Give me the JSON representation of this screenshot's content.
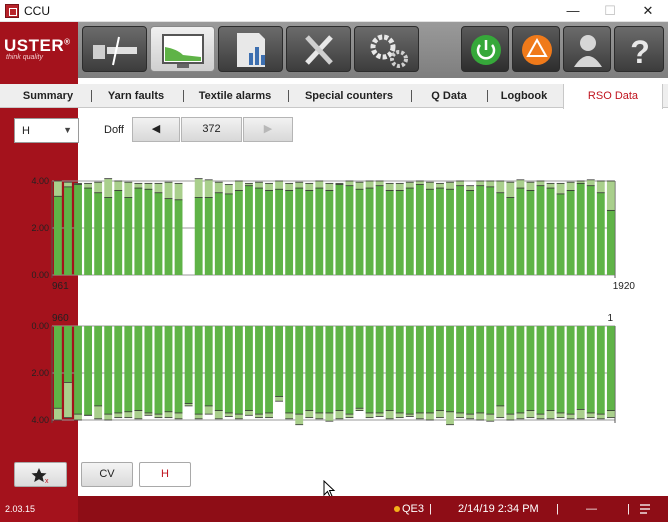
{
  "window": {
    "title": "CCU",
    "minimize": "—",
    "maximize": "☐",
    "close": "✕"
  },
  "brand": {
    "logo": "USTER",
    "reg": "®",
    "tagline": "think quality",
    "version": "2.03.15"
  },
  "toolbar": {
    "buttons": [
      {
        "name": "yarn-path-button",
        "icon": "yarn-path-icon"
      },
      {
        "name": "monitor-button",
        "icon": "monitor-chart-icon",
        "active": true
      },
      {
        "name": "report-button",
        "icon": "report-icon"
      },
      {
        "name": "tools-button",
        "icon": "tools-icon"
      },
      {
        "name": "settings-button",
        "icon": "gears-icon"
      },
      {
        "name": "power-button",
        "icon": "power-icon"
      },
      {
        "name": "alarm-button",
        "icon": "alarm-triangle-icon"
      },
      {
        "name": "user-button",
        "icon": "user-icon"
      },
      {
        "name": "help-button",
        "icon": "help-icon"
      }
    ]
  },
  "tabs": [
    {
      "label": "Summary"
    },
    {
      "label": "Yarn faults"
    },
    {
      "label": "Textile alarms"
    },
    {
      "label": "Special counters"
    },
    {
      "label": "Q Data"
    },
    {
      "label": "Logbook"
    },
    {
      "label": "RSO Data",
      "active": true
    }
  ],
  "controls": {
    "select_value": "H",
    "doff_label": "Doff",
    "prev_label": "◀",
    "doff_value": "372",
    "next_label": "▶"
  },
  "chart_data": [
    {
      "type": "bar",
      "orientation": "upward",
      "yticks": [
        "4.00",
        "2.00",
        "0.00"
      ],
      "ylim": [
        0,
        4
      ],
      "x_start_label": "961",
      "x_end_label": "1920",
      "series": [
        {
          "values": [
            3.35,
            3.75,
            3.85,
            3.7,
            3.5,
            3.3,
            3.6,
            3.3,
            3.7,
            3.65,
            3.5,
            3.25,
            3.2,
            0,
            3.3,
            3.3,
            3.5,
            3.45,
            3.6,
            3.8,
            3.7,
            3.6,
            3.65,
            3.6,
            3.7,
            3.6,
            3.7,
            3.6,
            3.85,
            3.8,
            3.65,
            3.7,
            3.8,
            3.6,
            3.6,
            3.7,
            3.85,
            3.65,
            3.7,
            3.65,
            3.8,
            3.6,
            3.8,
            3.75,
            3.5,
            3.3,
            3.7,
            3.6,
            3.8,
            3.7,
            3.45,
            3.6,
            3.9,
            3.8,
            3.5,
            2.75
          ]
        },
        {
          "values": [
            4.0,
            3.95,
            3.9,
            3.9,
            3.95,
            4.1,
            4.0,
            3.95,
            3.9,
            3.9,
            3.9,
            3.95,
            3.9,
            0,
            4.1,
            4.05,
            3.95,
            3.85,
            4.0,
            3.9,
            3.95,
            3.9,
            4.0,
            3.9,
            3.95,
            3.9,
            4.0,
            3.9,
            3.9,
            4.0,
            3.95,
            4.0,
            4.0,
            3.9,
            3.9,
            3.95,
            4.0,
            3.95,
            3.9,
            3.95,
            4.0,
            3.8,
            4.0,
            4.0,
            4.0,
            3.95,
            4.05,
            3.95,
            4.0,
            3.9,
            3.9,
            3.95,
            4.0,
            4.05,
            4.0,
            4.0
          ]
        }
      ]
    },
    {
      "type": "bar",
      "orientation": "downward",
      "yticks": [
        "0.00",
        "2.00",
        "4.00"
      ],
      "ylim": [
        0,
        4
      ],
      "x_start_label": "960",
      "x_end_label": "1",
      "series": [
        {
          "values": [
            3.5,
            2.4,
            3.75,
            3.8,
            3.4,
            3.75,
            3.7,
            3.65,
            3.6,
            3.7,
            3.75,
            3.65,
            3.7,
            3.3,
            3.75,
            3.4,
            3.6,
            3.7,
            3.75,
            3.6,
            3.75,
            3.7,
            3.0,
            3.7,
            3.75,
            3.6,
            3.7,
            3.7,
            3.6,
            3.75,
            3.5,
            3.7,
            3.7,
            3.6,
            3.7,
            3.75,
            3.7,
            3.7,
            3.6,
            3.65,
            3.7,
            3.75,
            3.7,
            3.75,
            3.4,
            3.75,
            3.7,
            3.6,
            3.75,
            3.6,
            3.7,
            3.75,
            3.55,
            3.7,
            3.75,
            3.6
          ]
        },
        {
          "values": [
            4.0,
            3.9,
            4.0,
            3.8,
            3.95,
            4.0,
            3.9,
            3.9,
            3.95,
            3.8,
            3.9,
            3.9,
            3.95,
            3.4,
            3.95,
            3.75,
            3.95,
            3.85,
            3.95,
            3.8,
            3.9,
            3.9,
            3.2,
            3.95,
            4.2,
            3.9,
            3.95,
            4.05,
            3.95,
            3.9,
            3.6,
            3.9,
            3.85,
            3.95,
            3.9,
            3.85,
            3.95,
            4.0,
            3.9,
            4.2,
            3.9,
            3.95,
            4.0,
            4.05,
            3.9,
            4.0,
            3.95,
            3.9,
            3.95,
            3.95,
            3.9,
            3.95,
            3.95,
            3.9,
            3.95,
            3.9
          ]
        }
      ]
    }
  ],
  "bottom": {
    "cv_label": "CV",
    "h_label": "H"
  },
  "status": {
    "dot_color": "#f4b21b",
    "machine": "QE3",
    "sep": "|",
    "datetime": "2/14/19 2:34 PM",
    "dash": "—"
  },
  "colors": {
    "brand_red": "#a4121c",
    "bar_dark": "#5fb347",
    "bar_light": "#a9cf8c",
    "accent_red": "#c0141f"
  }
}
